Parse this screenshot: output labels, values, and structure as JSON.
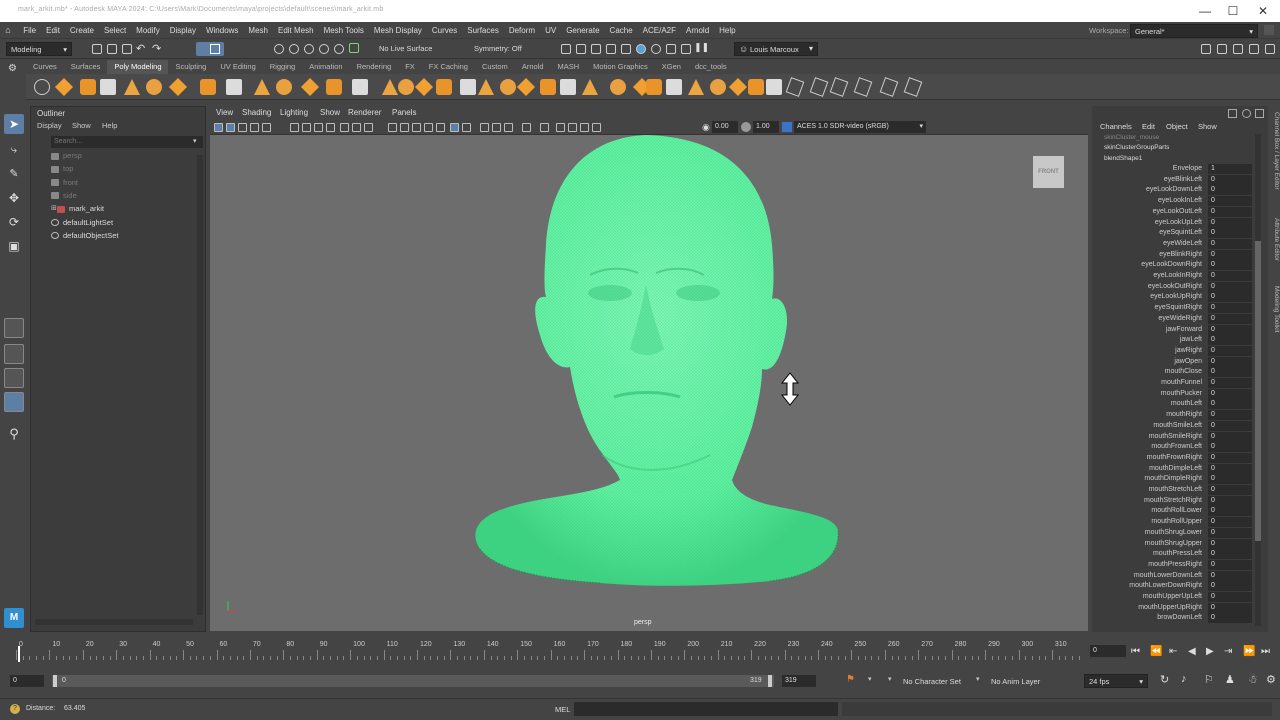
{
  "window": {
    "title": "mark_arkit.mb* - Autodesk MAYA 2024: C:\\Users\\Mark\\Documents\\maya\\projects\\default\\scenes\\mark_arkit.mb"
  },
  "menubar": {
    "items": [
      "File",
      "Edit",
      "Create",
      "Select",
      "Modify",
      "Display",
      "Windows",
      "Mesh",
      "Edit Mesh",
      "Mesh Tools",
      "Mesh Display",
      "Curves",
      "Surfaces",
      "Deform",
      "UV",
      "Generate",
      "Cache",
      "ACE/A2F",
      "Arnold",
      "Help"
    ],
    "workspace_label": "Workspace:",
    "workspace_value": "General*"
  },
  "statusline": {
    "mode": "Modeling",
    "live_surface": "No Live Surface",
    "symmetry": "Symmetry: Off",
    "user": "Louis Marcoux"
  },
  "shelf": {
    "tabs": [
      "Curves",
      "Surfaces",
      "Poly Modeling",
      "Sculpting",
      "UV Editing",
      "Rigging",
      "Animation",
      "Rendering",
      "FX",
      "FX Caching",
      "Custom",
      "Arnold",
      "MASH",
      "Motion Graphics",
      "XGen",
      "dcc_tools"
    ],
    "active_tab": "Poly Modeling"
  },
  "outliner": {
    "title": "Outliner",
    "menu": [
      "Display",
      "Show",
      "Help"
    ],
    "search_placeholder": "Search...",
    "items": [
      {
        "label": "persp",
        "dim": true
      },
      {
        "label": "top",
        "dim": true
      },
      {
        "label": "front",
        "dim": true
      },
      {
        "label": "side",
        "dim": true
      },
      {
        "label": "mark_arkit",
        "dim": false
      },
      {
        "label": "defaultLightSet",
        "dim": false
      },
      {
        "label": "defaultObjectSet",
        "dim": false
      }
    ]
  },
  "viewport": {
    "menu": [
      "View",
      "Shading",
      "Lighting",
      "Show",
      "Renderer",
      "Panels"
    ],
    "exposure": "0.00",
    "gamma": "1.00",
    "colorspace": "ACES 1.0 SDR-video (sRGB)",
    "view_cube_label": "FRONT",
    "camera_label": "persp",
    "mesh_color": "#5ef0a0"
  },
  "channel_box": {
    "menu": [
      "Channels",
      "Edit",
      "Object",
      "Show"
    ],
    "nodes": [
      "skinCluster_mouse",
      "skinClusterGroupParts",
      "blendShape1"
    ],
    "attributes": [
      {
        "name": "Envelope",
        "value": "1"
      },
      {
        "name": "eyeBlinkLeft",
        "value": "0"
      },
      {
        "name": "eyeLookDownLeft",
        "value": "0"
      },
      {
        "name": "eyeLookInLeft",
        "value": "0"
      },
      {
        "name": "eyeLookOutLeft",
        "value": "0"
      },
      {
        "name": "eyeLookUpLeft",
        "value": "0"
      },
      {
        "name": "eyeSquintLeft",
        "value": "0"
      },
      {
        "name": "eyeWideLeft",
        "value": "0"
      },
      {
        "name": "eyeBlinkRight",
        "value": "0"
      },
      {
        "name": "eyeLookDownRight",
        "value": "0"
      },
      {
        "name": "eyeLookInRight",
        "value": "0"
      },
      {
        "name": "eyeLookOutRight",
        "value": "0"
      },
      {
        "name": "eyeLookUpRight",
        "value": "0"
      },
      {
        "name": "eyeSquintRight",
        "value": "0"
      },
      {
        "name": "eyeWideRight",
        "value": "0"
      },
      {
        "name": "jawForward",
        "value": "0"
      },
      {
        "name": "jawLeft",
        "value": "0"
      },
      {
        "name": "jawRight",
        "value": "0"
      },
      {
        "name": "jawOpen",
        "value": "0"
      },
      {
        "name": "mouthClose",
        "value": "0"
      },
      {
        "name": "mouthFunnel",
        "value": "0"
      },
      {
        "name": "mouthPucker",
        "value": "0"
      },
      {
        "name": "mouthLeft",
        "value": "0"
      },
      {
        "name": "mouthRight",
        "value": "0"
      },
      {
        "name": "mouthSmileLeft",
        "value": "0"
      },
      {
        "name": "mouthSmileRight",
        "value": "0"
      },
      {
        "name": "mouthFrownLeft",
        "value": "0"
      },
      {
        "name": "mouthFrownRight",
        "value": "0"
      },
      {
        "name": "mouthDimpleLeft",
        "value": "0"
      },
      {
        "name": "mouthDimpleRight",
        "value": "0"
      },
      {
        "name": "mouthStretchLeft",
        "value": "0"
      },
      {
        "name": "mouthStretchRight",
        "value": "0"
      },
      {
        "name": "mouthRollLower",
        "value": "0"
      },
      {
        "name": "mouthRollUpper",
        "value": "0"
      },
      {
        "name": "mouthShrugLower",
        "value": "0"
      },
      {
        "name": "mouthShrugUpper",
        "value": "0"
      },
      {
        "name": "mouthPressLeft",
        "value": "0"
      },
      {
        "name": "mouthPressRight",
        "value": "0"
      },
      {
        "name": "mouthLowerDownLeft",
        "value": "0"
      },
      {
        "name": "mouthLowerDownRight",
        "value": "0"
      },
      {
        "name": "mouthUpperUpLeft",
        "value": "0"
      },
      {
        "name": "mouthUpperUpRight",
        "value": "0"
      },
      {
        "name": "browDownLeft",
        "value": "0"
      }
    ]
  },
  "side_tabs": [
    "Channel Box / Layer Editor",
    "Attribute Editor",
    "Modeling Toolkit"
  ],
  "timeline": {
    "ticks": [
      "0",
      "10",
      "20",
      "30",
      "40",
      "50",
      "60",
      "70",
      "80",
      "90",
      "100",
      "110",
      "120",
      "130",
      "140",
      "150",
      "160",
      "170",
      "180",
      "190",
      "200",
      "210",
      "220",
      "230",
      "240",
      "250",
      "260",
      "270",
      "280",
      "290",
      "300",
      "310"
    ],
    "current_frame": "0",
    "range_start": "0",
    "range_start_inner": "0",
    "range_end_inner": "319",
    "range_end": "319",
    "character_set": "No Character Set",
    "anim_layer": "No Anim Layer",
    "fps": "24 fps"
  },
  "helpline": {
    "distance_label": "Distance:",
    "distance_value": "63.405",
    "command_type": "MEL"
  }
}
